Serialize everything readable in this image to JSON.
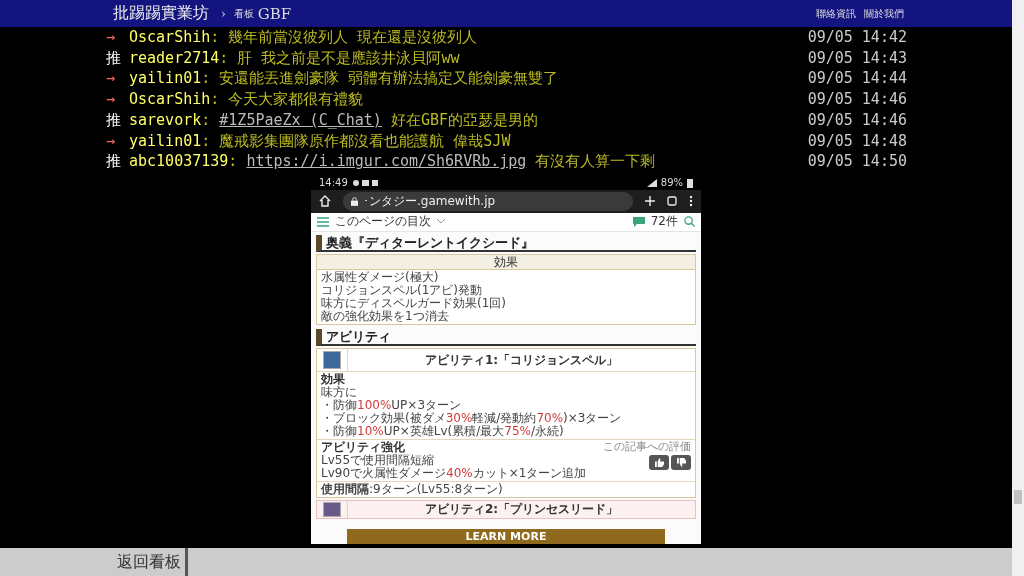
{
  "header": {
    "site": "批踢踢實業坊",
    "separator": "›",
    "board_label": "看板",
    "board": "GBF",
    "links": [
      "聯絡資訊",
      "關於我們"
    ]
  },
  "comments": [
    {
      "kind": "arrow",
      "tag": "→",
      "user": "OscarShih",
      "content": [
        {
          "kind": "text",
          "text": ": 幾年前當沒彼列人 現在還是沒彼列人"
        }
      ],
      "time": "09/05 14:42"
    },
    {
      "kind": "push",
      "tag": "推",
      "user": "reader2714",
      "content": [
        {
          "kind": "text",
          "text": ": 肝 我之前是不是應該井泳貝阿ww"
        }
      ],
      "time": "09/05 14:43"
    },
    {
      "kind": "arrow",
      "tag": "→",
      "user": "yailin01",
      "content": [
        {
          "kind": "text",
          "text": ": 安還能丟進劍豪隊 弱體有辦法搞定又能劍豪無雙了"
        }
      ],
      "time": "09/05 14:44"
    },
    {
      "kind": "arrow",
      "tag": "→",
      "user": "OscarShih",
      "content": [
        {
          "kind": "text",
          "text": ": 今天大家都很有禮貌"
        }
      ],
      "time": "09/05 14:46"
    },
    {
      "kind": "push",
      "tag": "推",
      "user": "sarevork",
      "content": [
        {
          "kind": "text",
          "text": ": "
        },
        {
          "kind": "link",
          "text": "#1Z5PaeZx (C_Chat)"
        },
        {
          "kind": "text",
          "text": " 好在GBF的亞瑟是男的"
        }
      ],
      "time": "09/05 14:46"
    },
    {
      "kind": "arrow",
      "tag": "→",
      "user": "yailin01",
      "content": [
        {
          "kind": "text",
          "text": ": 魔戒影集團隊原作都沒看也能護航 偉哉SJW"
        }
      ],
      "time": "09/05 14:48"
    },
    {
      "kind": "push",
      "tag": "推",
      "user": "abc10037139",
      "content": [
        {
          "kind": "text",
          "text": ": "
        },
        {
          "kind": "link",
          "text": "https://i.imgur.com/Sh6RVRb.jpg"
        },
        {
          "kind": "text",
          "text": " 有沒有人算一下剩"
        }
      ],
      "time": "09/05 14:50"
    }
  ],
  "screenshot": {
    "status_bar": {
      "time": "14:49",
      "battery": "89%"
    },
    "address_bar": {
      "url": "･ンタジー.gamewith.jp"
    },
    "toc_bar": {
      "label": "このページの目次",
      "comments": "72件"
    },
    "special_attack": {
      "heading": "奥義『ディターレントイクシード』",
      "table_header": "効果",
      "lines": [
        "水属性ダメージ(極大)",
        "コリジョンスペル(1アビ)発動",
        "味方にディスペルガード効果(1回)",
        "敵の強化効果を1つ消去"
      ]
    },
    "abilities_heading": "アビリティ",
    "ability_1": {
      "title": "アビリティ1:「コリジョンスペル」",
      "effect_label": "効果",
      "target": "味方に",
      "bullets": [
        [
          {
            "text": "・防御",
            "emphasis": false
          },
          {
            "text": "100%",
            "emphasis": true
          },
          {
            "text": "UP×3ターン",
            "emphasis": false
          }
        ],
        [
          {
            "text": "・ブロック効果(被ダメ",
            "emphasis": false
          },
          {
            "text": "30%",
            "emphasis": true
          },
          {
            "text": "軽減/発動約",
            "emphasis": false
          },
          {
            "text": "70%",
            "emphasis": true
          },
          {
            "text": ")×3ターン",
            "emphasis": false
          }
        ],
        [
          {
            "text": "・防御",
            "emphasis": false
          },
          {
            "text": "10%",
            "emphasis": true
          },
          {
            "text": "UP×英雄Lv(累積/最大",
            "emphasis": false
          },
          {
            "text": "75%",
            "emphasis": true
          },
          {
            "text": "/永続)",
            "emphasis": false
          }
        ]
      ],
      "upgrade_label": "アビリティ強化",
      "upgrade_lines": [
        [
          {
            "text": "Lv55で使用間隔短縮",
            "emphasis": false
          }
        ],
        [
          {
            "text": "Lv90で火属性ダメージ",
            "emphasis": false
          },
          {
            "text": "40%",
            "emphasis": true
          },
          {
            "text": "カット×1ターン追加",
            "emphasis": false
          }
        ]
      ],
      "interval": "**使用間隔**:9ターン(Lv55:8ターン)"
    },
    "rating": {
      "label": "この記事への評価"
    },
    "ability_2": {
      "title": "アビリティ2:「プリンセスリード」"
    },
    "ad": {
      "button": "LEARN MORE"
    }
  },
  "footer": {
    "back": "返回看板"
  }
}
